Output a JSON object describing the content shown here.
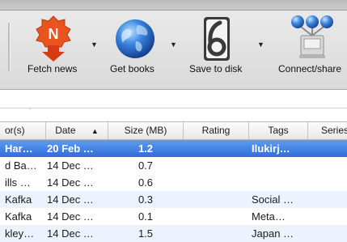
{
  "toolbar": {
    "buttons": [
      {
        "label": "Fetch news",
        "icon": "news-shield-icon",
        "has_menu": true,
        "badge": "N"
      },
      {
        "label": "Get books",
        "icon": "globe-icon",
        "has_menu": true
      },
      {
        "label": "Save to disk",
        "icon": "disk-icon",
        "has_menu": true
      },
      {
        "label": "Connect/share",
        "icon": "network-icon",
        "has_menu": false
      }
    ]
  },
  "table": {
    "columns": [
      {
        "label": "or(s)"
      },
      {
        "label": "Date",
        "sort": "▲"
      },
      {
        "label": "Size (MB)"
      },
      {
        "label": "Rating"
      },
      {
        "label": "Tags"
      },
      {
        "label": "Series"
      }
    ],
    "rows": [
      {
        "author": "Har…",
        "date": "20 Feb …",
        "size": "1.2",
        "rating": "",
        "tags": "Ilukirj…",
        "series": "",
        "selected": true
      },
      {
        "author": "d Ba…",
        "date": "14 Dec …",
        "size": "0.7",
        "rating": "",
        "tags": "",
        "series": ""
      },
      {
        "author": "ills …",
        "date": "14 Dec …",
        "size": "0.6",
        "rating": "",
        "tags": "",
        "series": ""
      },
      {
        "author": "Kafka",
        "date": "14 Dec …",
        "size": "0.3",
        "rating": "",
        "tags": "Social …",
        "series": ""
      },
      {
        "author": "Kafka",
        "date": "14 Dec …",
        "size": "0.1",
        "rating": "",
        "tags": "Meta…",
        "series": ""
      },
      {
        "author": "kley…",
        "date": "14 Dec …",
        "size": "1.5",
        "rating": "",
        "tags": "Japan …",
        "series": ""
      }
    ]
  },
  "colors": {
    "selection": "#2e6ed8",
    "alt_row": "#edf3fe",
    "fetch_icon": "#e8531e",
    "globe": "#2a6fd4"
  }
}
